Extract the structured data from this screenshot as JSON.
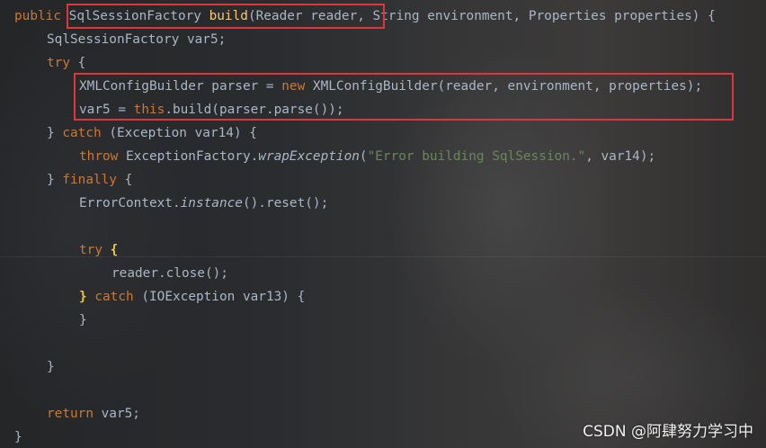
{
  "code": {
    "l1": {
      "public": "public ",
      "type": "SqlSessionFactory ",
      "method": "build",
      "params": "(Reader reader, String environment, Properties properties) {"
    },
    "l2": {
      "text": "SqlSessionFactory var5;"
    },
    "l3": {
      "kw": "try",
      "rest": " {"
    },
    "l4": {
      "a": "XMLConfigBuilder parser = ",
      "kw": "new",
      "b": " XMLConfigBuilder(reader, environment, properties);"
    },
    "l5": {
      "a": "var5 = ",
      "kw": "this",
      "b": ".build(parser.parse());"
    },
    "l6": {
      "a": "} ",
      "kw": "catch",
      "b": " (Exception var14) {"
    },
    "l7": {
      "kw": "throw",
      "a": " ExceptionFactory.",
      "it": "wrapException",
      "b": "(",
      "str": "\"Error building SqlSession.\"",
      "c": ", var14);"
    },
    "l8": {
      "a": "} ",
      "kw": "finally",
      "b": " {"
    },
    "l9": {
      "a": "ErrorContext.",
      "it": "instance",
      "b": "().reset();"
    },
    "l10": {
      "kw": "try",
      "sp": " ",
      "brace": "{"
    },
    "l11": {
      "text": "reader.close();"
    },
    "l12": {
      "brace": "}",
      "sp": " ",
      "kw": "catch",
      "b": " (IOException var13) {"
    },
    "l13": {
      "text": "}"
    },
    "l14": {
      "text": "}"
    },
    "l15": {
      "kw": "return",
      "b": " var5;"
    },
    "l16": {
      "text": "}"
    }
  },
  "watermark": "CSDN @阿肆努力学习中",
  "colors": {
    "highlight_box": "#e0353a",
    "keyword": "#cc7832",
    "method": "#ffc66d",
    "string": "#6a8759",
    "text": "#a9b7c6"
  }
}
